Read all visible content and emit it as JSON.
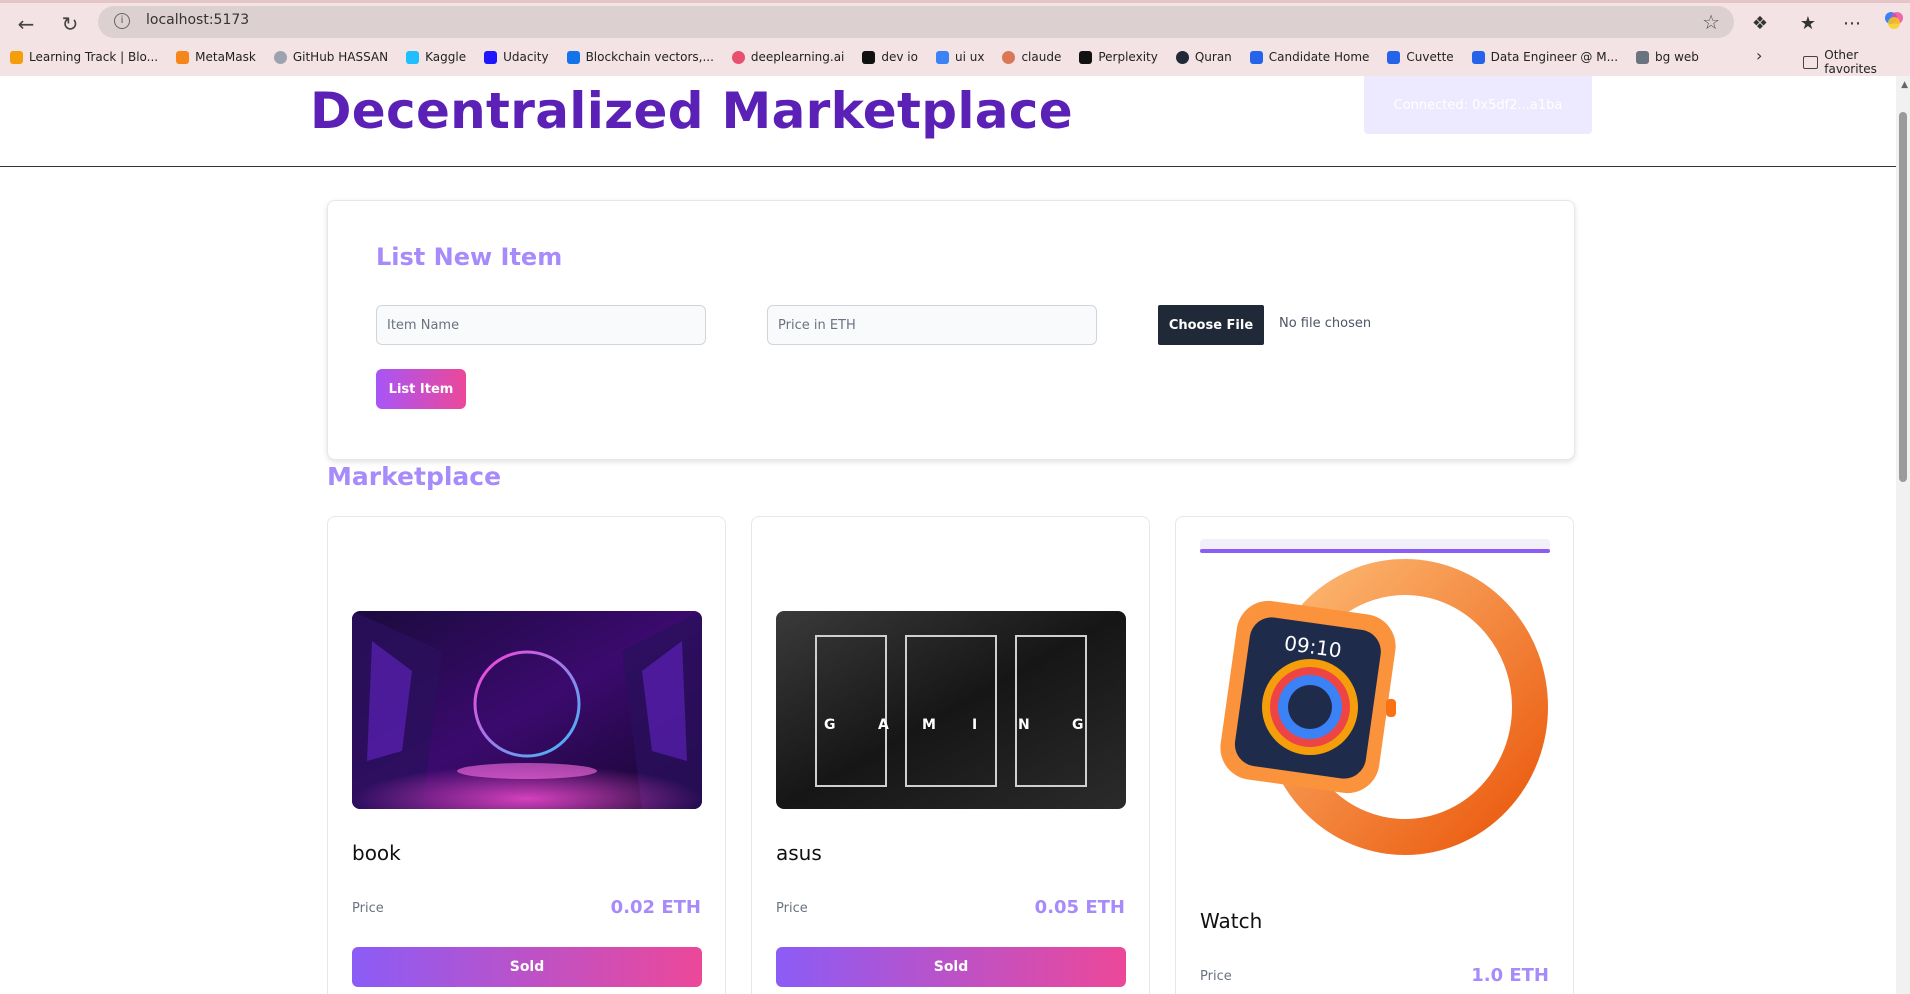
{
  "browser": {
    "url": "localhost:5173",
    "bookmarks": [
      {
        "label": "Learning Track | Blo...",
        "icon": "bars-icon",
        "color": "#f59e0b"
      },
      {
        "label": "MetaMask",
        "icon": "fox-icon",
        "color": "#f6851b"
      },
      {
        "label": "GitHub HASSAN",
        "icon": "github-icon",
        "color": "#9ca3af"
      },
      {
        "label": "Kaggle",
        "icon": "kaggle-icon",
        "color": "#20beff"
      },
      {
        "label": "Udacity",
        "icon": "udacity-icon",
        "color": "#2015ff"
      },
      {
        "label": "Blockchain vectors,...",
        "icon": "freepik-icon",
        "color": "#1273eb"
      },
      {
        "label": "deeplearning.ai",
        "icon": "deeplearning-icon",
        "color": "#e94f6e"
      },
      {
        "label": "dev io",
        "icon": "devio-icon",
        "color": "#111111"
      },
      {
        "label": "ui ux",
        "icon": "uiux-icon",
        "color": "#3b82f6"
      },
      {
        "label": "claude",
        "icon": "claude-icon",
        "color": "#d97757"
      },
      {
        "label": "Perplexity",
        "icon": "perplexity-icon",
        "color": "#111111"
      },
      {
        "label": "Quran",
        "icon": "quran-icon",
        "color": "#1f2937"
      },
      {
        "label": "Candidate Home",
        "icon": "candidate-icon",
        "color": "#2563eb"
      },
      {
        "label": "Cuvette",
        "icon": "cuvette-icon",
        "color": "#2563eb"
      },
      {
        "label": "Data Engineer @ M...",
        "icon": "doc-icon",
        "color": "#2563eb"
      },
      {
        "label": "bg web",
        "icon": "hash-icon",
        "color": "#6b7280"
      }
    ],
    "other_favorites": "Other favorites"
  },
  "header": {
    "title": "Decentralized Marketplace",
    "connected": "Connected: 0x5df2...a1ba"
  },
  "form": {
    "title": "List New Item",
    "name_placeholder": "Item Name",
    "price_placeholder": "Price in ETH",
    "choose_file": "Choose File",
    "no_file": "No file chosen",
    "submit": "List Item"
  },
  "marketplace": {
    "title": "Marketplace",
    "price_label": "Price",
    "items": [
      {
        "name": "book",
        "price": "0.02 ETH",
        "status": "Sold"
      },
      {
        "name": "asus",
        "price": "0.05 ETH",
        "status": "Sold"
      },
      {
        "name": "Watch",
        "price": "1.0 ETH"
      }
    ],
    "watch_time": "09:10",
    "tuf_letters": [
      "G",
      "A",
      "M",
      "I",
      "N",
      "G"
    ]
  },
  "colors": {
    "title": "#5b21b6",
    "accent": "#a78bfa",
    "button_gradient_start": "#8b5cf6",
    "button_gradient_end": "#ec4899"
  }
}
